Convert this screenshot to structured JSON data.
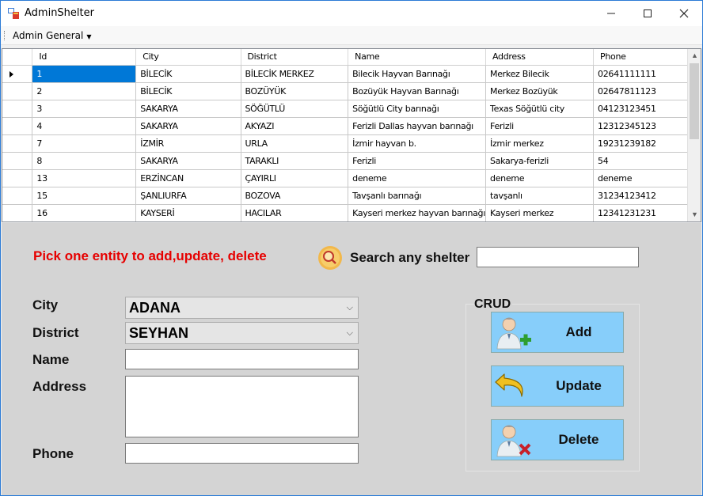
{
  "window": {
    "title": "AdminShelter",
    "minimize_glyph": "—",
    "maximize_glyph": "☐",
    "close_glyph": "✕"
  },
  "menu": {
    "items": [
      {
        "label": "Admin General"
      }
    ]
  },
  "grid": {
    "columns": [
      "Id",
      "City",
      "District",
      "Name",
      "Address",
      "Phone"
    ],
    "rows": [
      [
        "1",
        "BİLECİK",
        "BİLECİK MERKEZ",
        "Bilecik Hayvan Barınağı",
        "Merkez Bilecik",
        "02641111111"
      ],
      [
        "2",
        "BİLECİK",
        "BOZÜYÜK",
        "Bozüyük Hayvan Barınağı",
        "Merkez Bozüyük",
        "02647811123"
      ],
      [
        "3",
        "SAKARYA",
        "SÖĞÜTLÜ",
        "Söğütlü City barınağı",
        "Texas Söğütlü city",
        "04123123451"
      ],
      [
        "4",
        "SAKARYA",
        "AKYAZI",
        "Ferizli Dallas hayvan barınağı",
        "Ferizli",
        "12312345123"
      ],
      [
        "7",
        "İZMİR",
        "URLA",
        "İzmir hayvan b.",
        "İzmir merkez",
        "19231239182"
      ],
      [
        "8",
        "SAKARYA",
        "TARAKLI",
        "Ferizli",
        "Sakarya-ferizli",
        "54"
      ],
      [
        "13",
        "ERZİNCAN",
        "ÇAYIRLI",
        "deneme",
        "deneme",
        "deneme"
      ],
      [
        "15",
        "ŞANLIURFA",
        "BOZOVA",
        "Tavşanlı barınağı",
        "tavşanlı",
        "31234123412"
      ],
      [
        "16",
        "KAYSERİ",
        "HACILAR",
        "Kayseri merkez hayvan barınağı",
        "Kayseri merkez",
        "12341231231"
      ]
    ],
    "selected_row": 0
  },
  "form": {
    "hint": "Pick one entity to add,update, delete",
    "search_label": "Search any shelter",
    "search_value": "",
    "city_label": "City",
    "city_value": "ADANA",
    "district_label": "District",
    "district_value": "SEYHAN",
    "name_label": "Name",
    "name_value": "",
    "address_label": "Address",
    "address_value": "",
    "phone_label": "Phone",
    "phone_value": ""
  },
  "crud": {
    "title": "CRUD",
    "add_label": "Add",
    "update_label": "Update",
    "delete_label": "Delete"
  },
  "colors": {
    "hint": "#e60000",
    "crud_button": "#87cefa",
    "selection": "#0078d7",
    "panel": "#d4d4d4"
  }
}
